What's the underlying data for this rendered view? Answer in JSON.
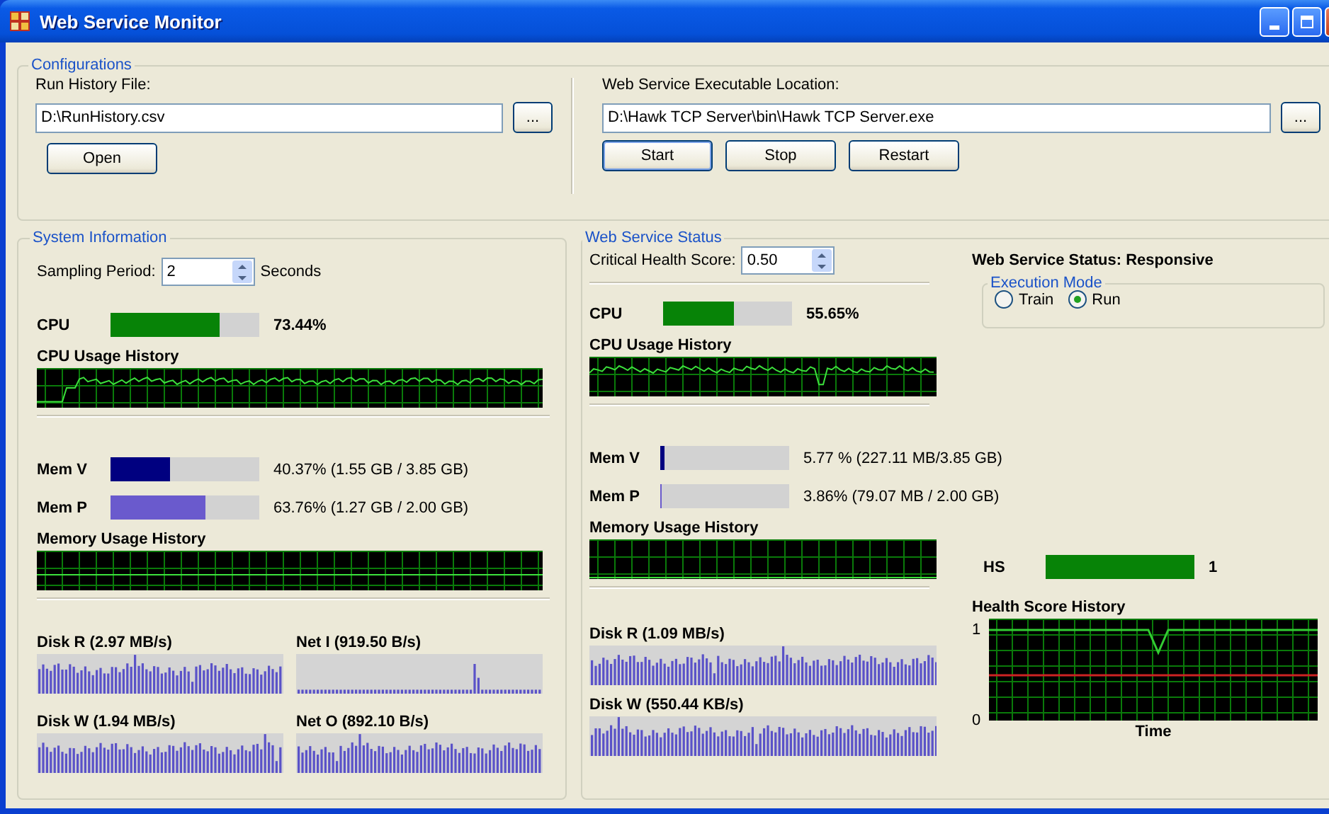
{
  "window": {
    "title": "Web Service Monitor"
  },
  "configurations": {
    "title": "Configurations",
    "run_history": {
      "label": "Run History File:",
      "value": "D:\\RunHistory.csv",
      "browse": "...",
      "button": "Open"
    },
    "executable": {
      "label": "Web Service Executable Location:",
      "value": "D:\\Hawk TCP Server\\bin\\Hawk TCP Server.exe",
      "browse": "...",
      "buttons": [
        "Start",
        "Stop",
        "Restart"
      ]
    }
  },
  "system_information": {
    "title": "System Information",
    "sampling": {
      "label": "Sampling Period:",
      "value": "2",
      "unit": "Seconds"
    },
    "cpu": {
      "label": "CPU",
      "level": 0.73,
      "reading": "73.44%"
    },
    "cpu_history_label": "CPU Usage History",
    "memory": [
      {
        "label": "Mem V",
        "level": 0.4,
        "reading": "40.37% (1.55 GB / 3.85 GB)",
        "color": "#000080"
      },
      {
        "label": "Mem P",
        "level": 0.64,
        "reading": "63.76% (1.27 GB / 2.00 GB)",
        "color": "#6a5acd"
      }
    ],
    "memory_history_label": "Memory Usage History",
    "io": [
      {
        "label": "Disk R (2.97 MB/s)"
      },
      {
        "label": "Net I (919.50 B/s)"
      },
      {
        "label": "Disk W (1.94 MB/s)"
      },
      {
        "label": "Net O (892.10 B/s)"
      }
    ]
  },
  "web_service_status": {
    "title": "Web Service Status",
    "critical": {
      "label": "Critical Health Score:",
      "value": "0.50"
    },
    "cpu": {
      "label": "CPU",
      "level": 0.55,
      "reading": "55.65%"
    },
    "cpu_history_label": "CPU Usage History",
    "memory": [
      {
        "label": "Mem V",
        "level": 0.03,
        "reading": "5.77 % (227.11 MB/3.85 GB)",
        "color": "#000080"
      },
      {
        "label": "Mem P",
        "level": 0.015,
        "reading": "3.86% (79.07 MB / 2.00 GB)",
        "color": "#6a5acd"
      }
    ],
    "memory_history_label": "Memory Usage History",
    "io": [
      {
        "label": "Disk R (1.09 MB/s)"
      },
      {
        "label": "Disk W (550.44 KB/s)"
      }
    ],
    "status": "Web Service Status: Responsive",
    "execution_mode": {
      "title": "Execution Mode",
      "options": [
        {
          "label": "Train",
          "selected": false
        },
        {
          "label": "Run",
          "selected": true
        }
      ]
    },
    "hs": {
      "label": "HS",
      "level": 1,
      "reading": "1"
    },
    "health_history": {
      "title": "Health Score History",
      "chart_data": {
        "type": "line",
        "grid": true,
        "xlabel": "Time",
        "ylim": [
          0,
          1
        ],
        "yticks": [
          0,
          1
        ],
        "series": [
          {
            "color": "#33cc33",
            "values": [
              1,
              1,
              1,
              1,
              1,
              1,
              1,
              1,
              1,
              1,
              1,
              1,
              1,
              1,
              1,
              1,
              1,
              0.75,
              1,
              1,
              1,
              1,
              1,
              1,
              1,
              1,
              1,
              1,
              1,
              1,
              1,
              1,
              1,
              1
            ]
          },
          {
            "color": "#cc2222",
            "values": [
              0.5,
              0.5,
              0.5,
              0.5,
              0.5,
              0.5,
              0.5,
              0.5,
              0.5,
              0.5,
              0.5,
              0.5,
              0.5,
              0.5,
              0.5,
              0.5,
              0.5,
              0.5,
              0.5,
              0.5,
              0.5,
              0.5,
              0.5,
              0.5,
              0.5,
              0.5,
              0.5,
              0.5,
              0.5,
              0.5,
              0.5,
              0.5,
              0.5,
              0.5
            ]
          }
        ]
      }
    }
  }
}
